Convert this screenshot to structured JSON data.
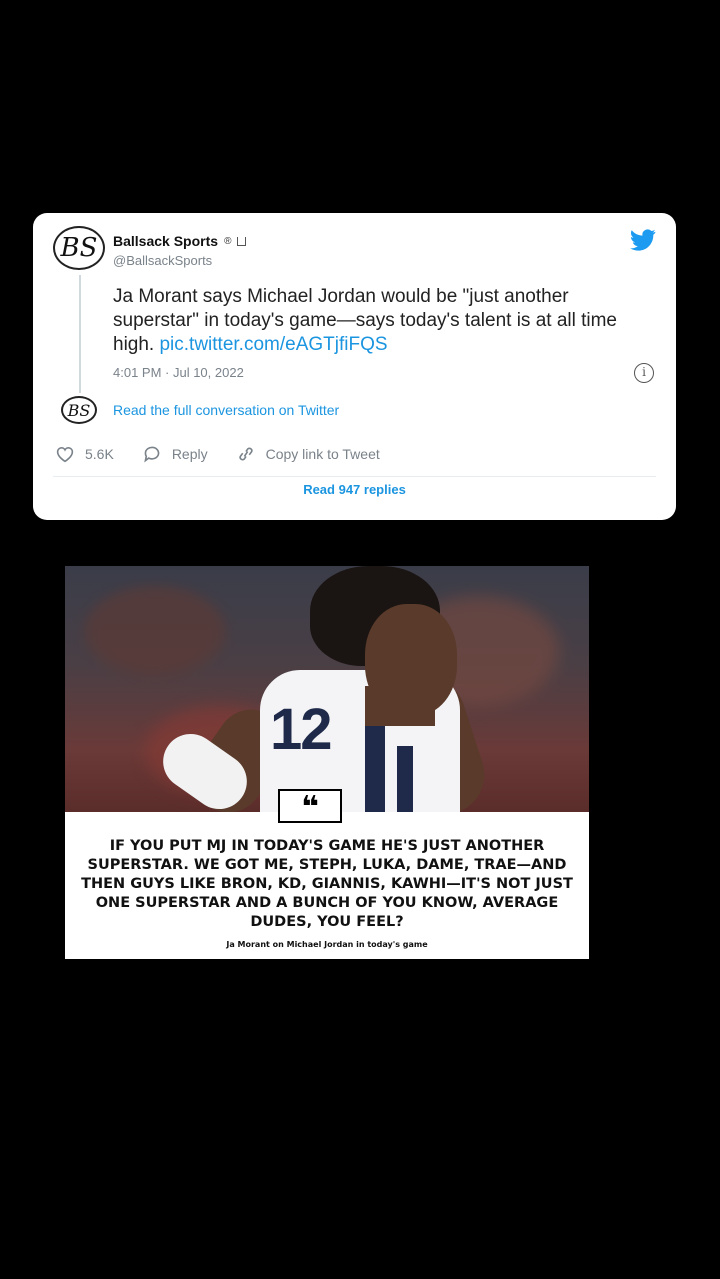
{
  "tweet": {
    "avatar_text": "BS",
    "display_name": "Ballsack Sports",
    "registered_mark": "®",
    "handle": "@BallsackSports",
    "text_before_link": "Ja Morant says Michael Jordan would be \"just another superstar\" in today's game—says today's talent is at all time high. ",
    "link": "pic.twitter.com/eAGTjfiFQS",
    "timestamp": "4:01 PM · Jul 10, 2022",
    "conversation_link": "Read the full conversation on Twitter",
    "likes": "5.6K",
    "reply_label": "Reply",
    "copy_link_label": "Copy link to Tweet",
    "read_replies": "Read 947 replies",
    "accent_color": "#1b95e0"
  },
  "image": {
    "jersey_number": "12",
    "quote_mark": "❝",
    "quote": "IF YOU PUT MJ IN TODAY'S GAME HE'S JUST ANOTHER SUPERSTAR. WE GOT ME, STEPH, LUKA, DAME, TRAE—AND THEN GUYS LIKE BRON, KD, GIANNIS, KAWHI—IT'S NOT JUST ONE SUPERSTAR AND A BUNCH OF YOU KNOW, AVERAGE DUDES, YOU FEEL?",
    "credit": "Ja Morant on Michael Jordan in today's game"
  }
}
